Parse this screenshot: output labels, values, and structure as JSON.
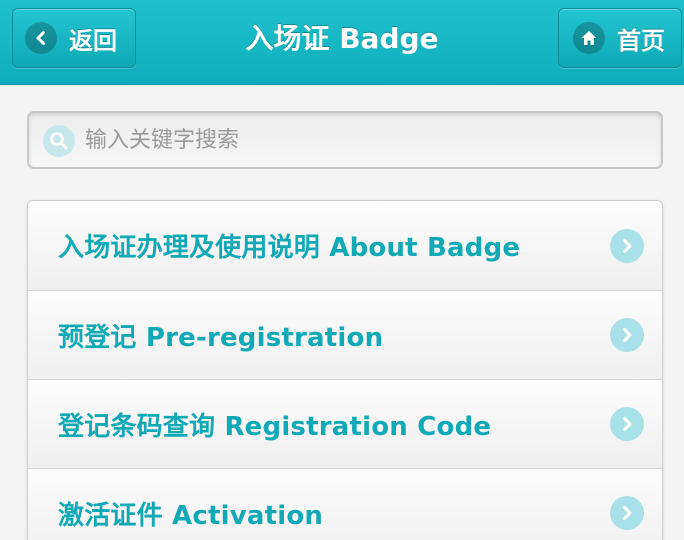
{
  "header": {
    "title": "入场证 Badge",
    "back_label": "返回",
    "home_label": "首页",
    "back_icon": "chevron-left-icon",
    "home_icon": "home-icon",
    "bg_color": "#14b4c1"
  },
  "search": {
    "placeholder": "输入关键字搜索",
    "value": "",
    "icon": "search-icon"
  },
  "menu": {
    "items": [
      {
        "label": "入场证办理及使用说明 About Badge"
      },
      {
        "label": "预登记 Pre-registration"
      },
      {
        "label": "登记条码查询 Registration Code"
      },
      {
        "label": "激活证件 Activation"
      }
    ],
    "accent_color": "#12a9b7",
    "chevron_icon": "chevron-right-icon"
  }
}
